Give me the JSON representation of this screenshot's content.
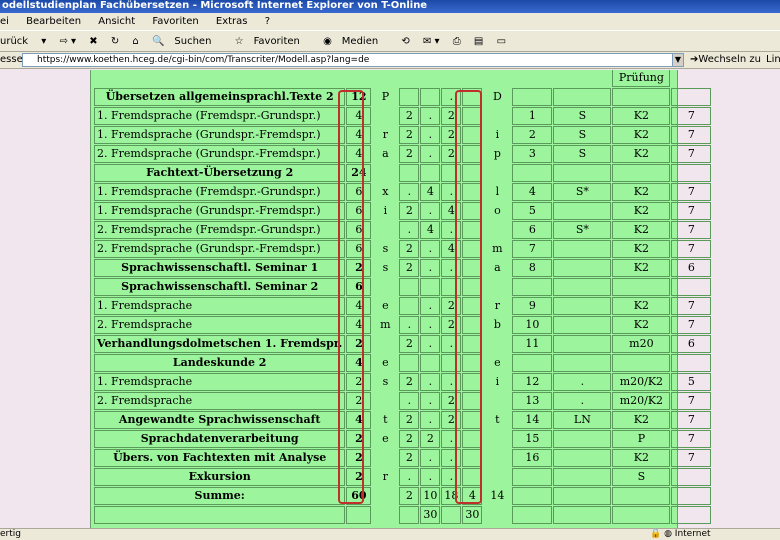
{
  "window": {
    "title": "odellstudienplan Fachübersetzen - Microsoft Internet Explorer von T-Online"
  },
  "menu": [
    "ei",
    "Bearbeiten",
    "Ansicht",
    "Favoriten",
    "Extras",
    "?"
  ],
  "toolbar": {
    "back": "urück",
    "search": "Suchen",
    "favorites": "Favoriten",
    "media": "Medien"
  },
  "address": {
    "label": "esse",
    "url": "https://www.koethen.hceg.de/cgi-bin/com/Transcriter/Modell.asp?lang=de",
    "go": "Wechseln zu",
    "links": "Link"
  },
  "status": {
    "left": "ertig",
    "zone": "Internet"
  },
  "table": {
    "header_pruefung": "Prüfung",
    "rows": [
      [
        "Übersetzen allgemeinsprachl.Texte 2",
        "12",
        "P",
        "",
        "",
        ".",
        "",
        "D",
        "",
        "",
        "",
        ""
      ],
      [
        "1. Fremdsprache (Fremdspr.-Grundspr.)",
        "4",
        "",
        "2",
        ".",
        "2",
        "",
        "",
        "1",
        "S",
        "K2",
        "7"
      ],
      [
        "1. Fremdsprache (Grundspr.-Fremdspr.)",
        "4",
        "r",
        "2",
        ".",
        "2",
        "",
        "i",
        "2",
        "S",
        "K2",
        "7"
      ],
      [
        "2. Fremdsprache (Grundspr.-Fremdspr.)",
        "4",
        "a",
        "2",
        ".",
        "2",
        "",
        "p",
        "3",
        "S",
        "K2",
        "7"
      ],
      [
        "Fachtext-Übersetzung 2",
        "24",
        "",
        "",
        "",
        "",
        "",
        "",
        "",
        "",
        "",
        ""
      ],
      [
        "1. Fremdsprache (Fremdspr.-Grundspr.)",
        "6",
        "x",
        ".",
        "4",
        ".",
        "",
        "l",
        "4",
        "S*",
        "K2",
        "7"
      ],
      [
        "1. Fremdsprache (Grundspr.-Fremdspr.)",
        "6",
        "i",
        "2",
        ".",
        "4",
        "",
        "o",
        "5",
        "",
        "K2",
        "7"
      ],
      [
        "2. Fremdsprache (Fremdspr.-Grundspr.)",
        "6",
        "",
        ".",
        "4",
        ".",
        "",
        "",
        "6",
        "S*",
        "K2",
        "7"
      ],
      [
        "2. Fremdsprache (Grundspr.-Fremdspr.)",
        "6",
        "s",
        "2",
        ".",
        "4",
        "",
        "m",
        "7",
        "",
        "K2",
        "7"
      ],
      [
        "Sprachwissenschaftl. Seminar 1",
        "2",
        "s",
        "2",
        ".",
        ".",
        "",
        "a",
        "8",
        "",
        "K2",
        "6"
      ],
      [
        "Sprachwissenschaftl. Seminar 2",
        "6",
        "",
        "",
        "",
        "",
        "",
        "",
        "",
        "",
        "",
        ""
      ],
      [
        "1. Fremdsprache",
        "4",
        "e",
        "",
        ".",
        "2",
        "",
        "r",
        "9",
        "",
        "K2",
        "7"
      ],
      [
        "2. Fremdsprache",
        "4",
        "m",
        ".",
        ".",
        "2",
        "",
        "b",
        "10",
        "",
        "K2",
        "7"
      ],
      [
        "Verhandlungsdolmetschen 1. Fremdspr.",
        "2",
        "",
        "2",
        ".",
        ".",
        "",
        "",
        "11",
        "",
        "m20",
        "6"
      ],
      [
        "Landeskunde 2",
        "4",
        "e",
        "",
        "",
        "",
        "",
        "e",
        "",
        "",
        "",
        ""
      ],
      [
        "1. Fremdsprache",
        "2",
        "s",
        "2",
        ".",
        ".",
        "",
        "i",
        "12",
        ".",
        "m20/K2",
        "5"
      ],
      [
        "2. Fremdsprache",
        "2",
        "",
        ".",
        ".",
        "2",
        "",
        "",
        "13",
        ".",
        "m20/K2",
        "7"
      ],
      [
        "Angewandte Sprachwissenschaft",
        "4",
        "t",
        "2",
        ".",
        "2",
        "",
        "t",
        "14",
        "LN",
        "K2",
        "7"
      ],
      [
        "Sprachdatenverarbeitung",
        "2",
        "e",
        "2",
        "2",
        ".",
        "",
        "",
        "15",
        "",
        "P",
        "7"
      ],
      [
        "Übers. von Fachtexten mit Analyse",
        "2",
        "",
        "2",
        ".",
        ".",
        "",
        "",
        "16",
        "",
        "K2",
        "7"
      ],
      [
        "Exkursion",
        "2",
        "r",
        ".",
        ".",
        ".",
        "",
        "",
        "",
        "",
        "S",
        ""
      ],
      [
        "Summe:",
        "60",
        "",
        "2",
        "10",
        "18",
        "4",
        "14",
        "",
        "",
        "",
        ""
      ],
      [
        "",
        "",
        "",
        "",
        "30",
        "",
        "30",
        "",
        "",
        "",
        "",
        ""
      ]
    ],
    "bold_rows": [
      0,
      4,
      9,
      10,
      13,
      14,
      17,
      18,
      19,
      20,
      21
    ]
  },
  "colors": {
    "page_green": "#9cf59c",
    "highlight": "#c0302a",
    "titlebar": "#1c4aa8"
  }
}
